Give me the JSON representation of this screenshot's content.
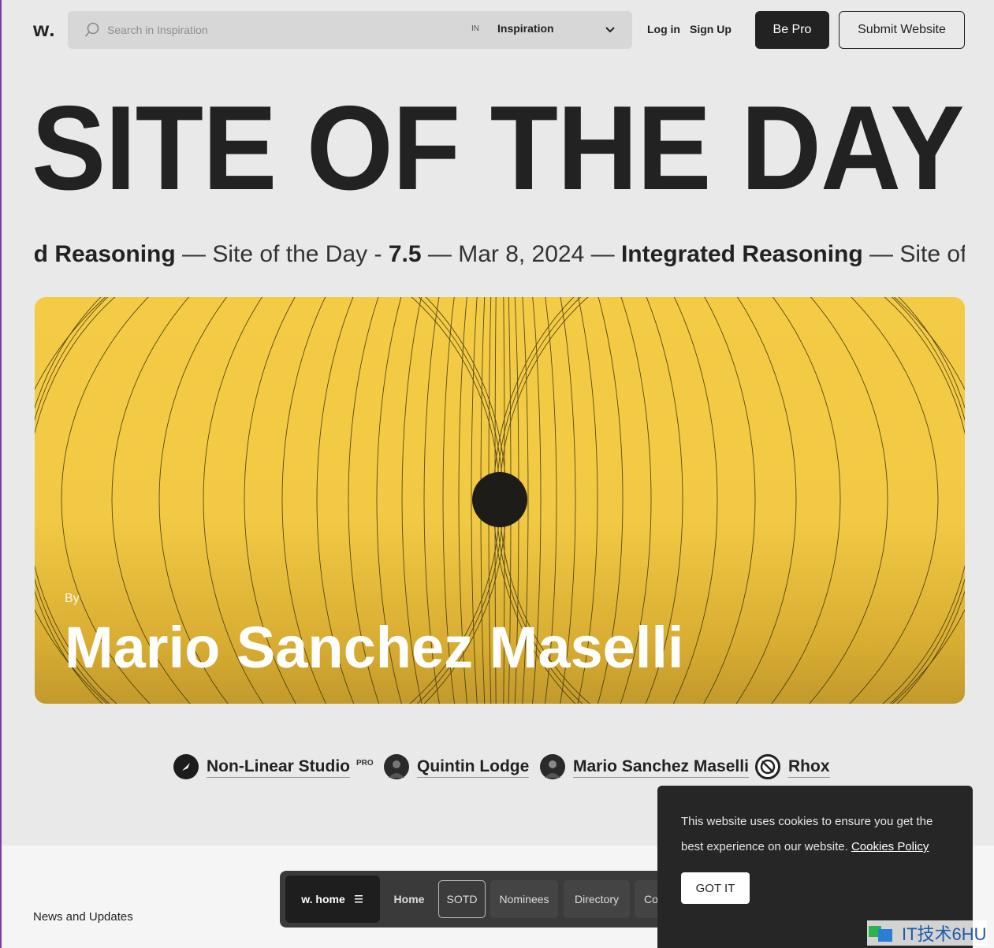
{
  "header": {
    "logo": "w.",
    "search_placeholder": "Search in Inspiration",
    "in_label": "IN",
    "scope": "Inspiration",
    "login": "Log in",
    "signup": "Sign Up",
    "be_pro": "Be Pro",
    "submit": "Submit Website"
  },
  "title": "SITE OF THE DAY",
  "ticker": {
    "partial_name": "ted Reasoning",
    "sep1": " — Site of the Day - ",
    "score": "7.5",
    "sep2": " — Mar 8, 2024 — ",
    "name": "Integrated Reasoning",
    "sep3": " — Site of the"
  },
  "hero": {
    "by": "By",
    "author": "Mario Sanchez Maselli",
    "accent_color": "#f4cb45"
  },
  "credits": [
    {
      "name": "Non-Linear Studio",
      "badge": "PRO"
    },
    {
      "name": "Quintin Lodge"
    },
    {
      "name": "Mario Sanchez Maselli"
    },
    {
      "name": "Rhox"
    }
  ],
  "footer": {
    "news": "News and Updates",
    "nav_home": "w. home",
    "nav_items": [
      "Home",
      "SOTD",
      "Nominees",
      "Directory",
      "Co"
    ]
  },
  "cookie": {
    "text": "This website uses cookies to ensure you get the best experience on our website.",
    "link": "Cookies Policy",
    "button": "GOT IT"
  },
  "watermark": "IT技术6HU"
}
